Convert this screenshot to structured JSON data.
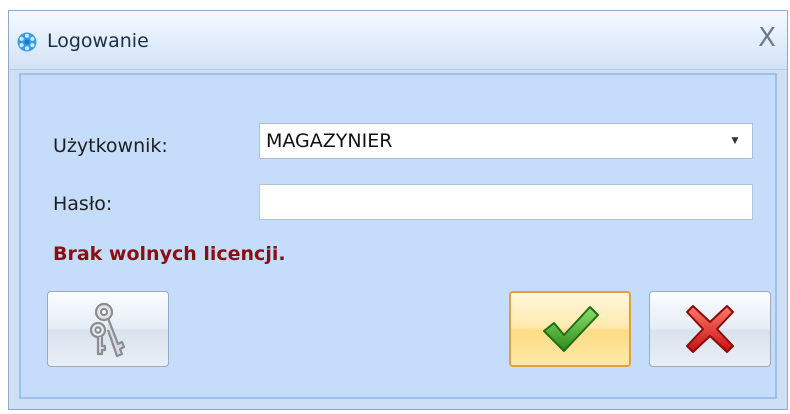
{
  "window": {
    "title": "Logowanie",
    "close_glyph": "X"
  },
  "form": {
    "user_label": "Użytkownik:",
    "user_value": "MAGAZYNIER",
    "password_label": "Hasło:",
    "password_value": "",
    "error_message": "Brak wolnych licencji."
  },
  "buttons": {
    "keys_icon": "keys-icon",
    "ok_icon": "checkmark-icon",
    "cancel_icon": "red-x-icon"
  },
  "colors": {
    "error_text": "#8b0f0f",
    "ok_focus_border": "#e0a040",
    "cancel_red": "#e01e1e",
    "ok_green": "#3fae2a"
  }
}
